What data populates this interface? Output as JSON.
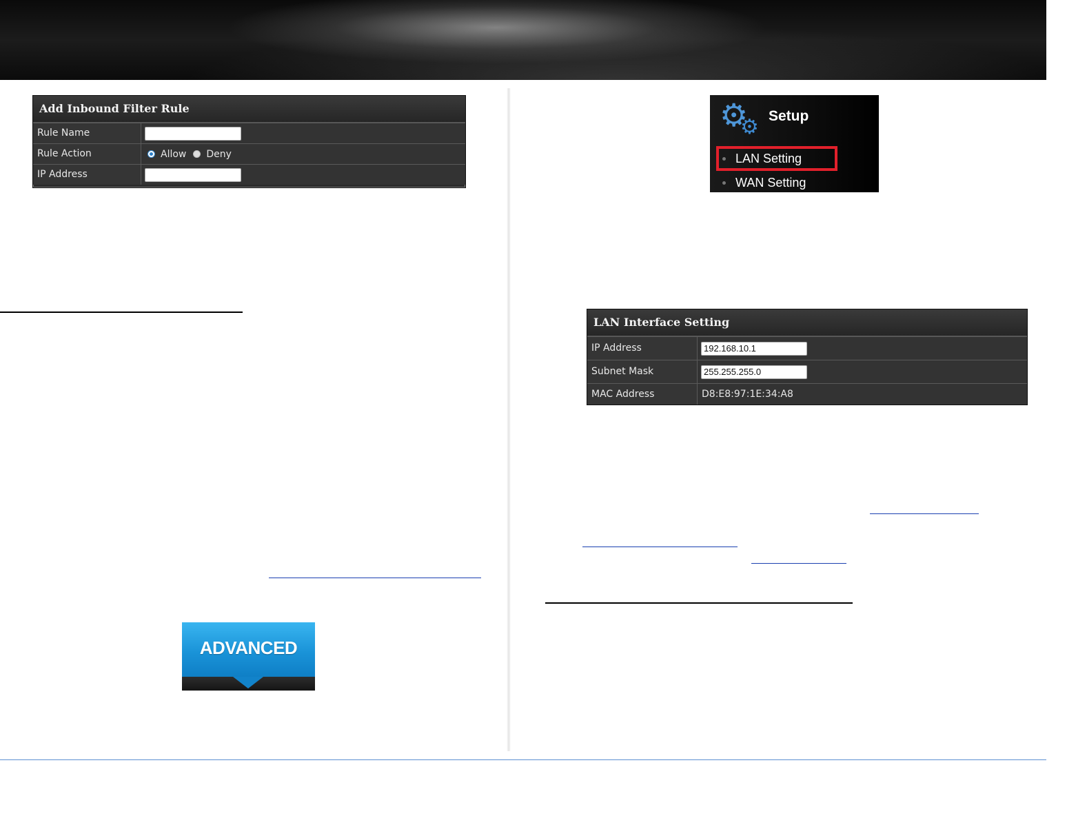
{
  "inbound_filter": {
    "title": "Add Inbound Filter Rule",
    "rule_name_label": "Rule Name",
    "rule_name_value": "",
    "rule_action_label": "Rule Action",
    "allow_label": "Allow",
    "deny_label": "Deny",
    "ip_address_label": "IP Address",
    "ip_address_value": ""
  },
  "setup_menu": {
    "title": "Setup",
    "items": [
      {
        "label": "LAN Setting"
      },
      {
        "label": "WAN Setting"
      }
    ]
  },
  "lan_interface": {
    "title": "LAN Interface Setting",
    "ip_address_label": "IP Address",
    "ip_address_value": "192.168.10.1",
    "subnet_mask_label": "Subnet Mask",
    "subnet_mask_value": "255.255.255.0",
    "mac_address_label": "MAC Address",
    "mac_address_value": "D8:E8:97:1E:34:A8"
  },
  "advanced_tab": {
    "label": "ADVANCED"
  },
  "colors": {
    "accent_blue": "#1a93d8",
    "highlight_red": "#e2202b",
    "panel_bg": "#2b2b2b"
  }
}
